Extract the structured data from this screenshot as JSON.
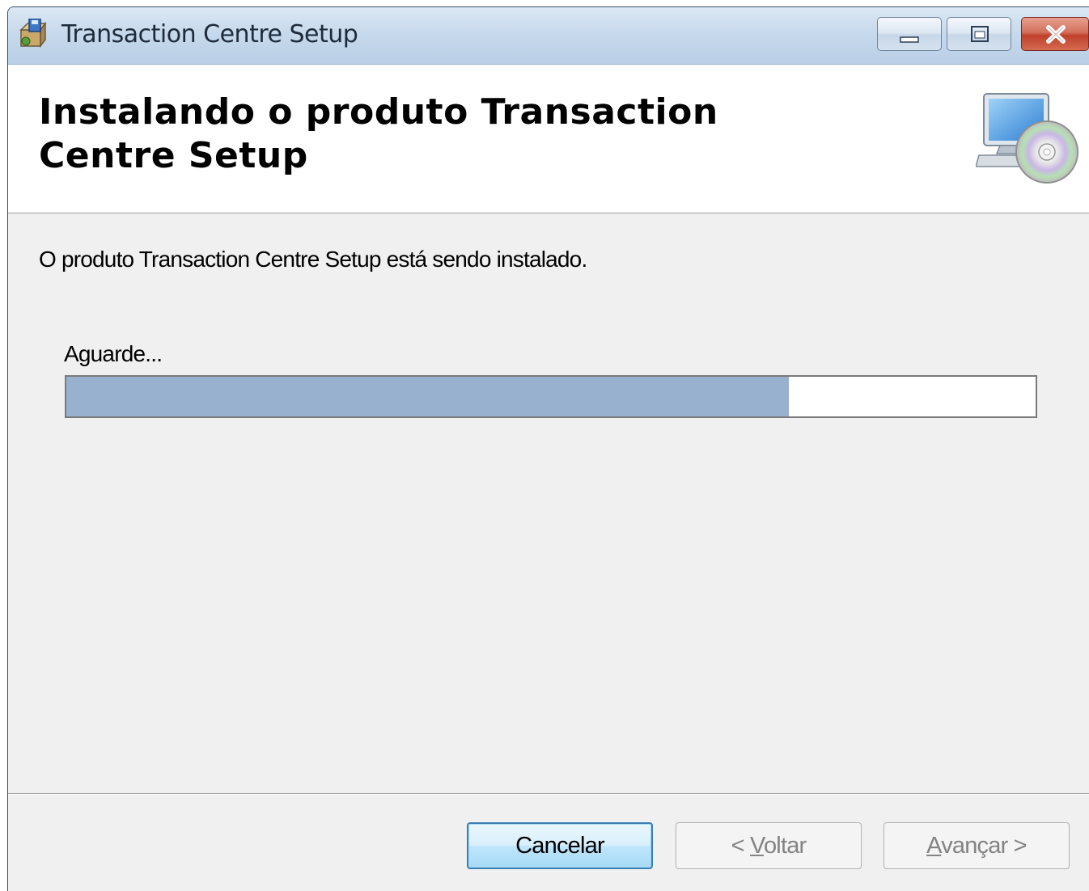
{
  "window": {
    "title": "Transaction Centre Setup"
  },
  "header": {
    "title": "Instalando o produto Transaction Centre Setup"
  },
  "body": {
    "description": "O produto Transaction Centre Setup está sendo instalado.",
    "status_label": "Aguarde...",
    "progress_fraction": 0.745
  },
  "buttons": {
    "cancel": "Cancelar",
    "back_prefix": "< ",
    "back_mnemonic": "V",
    "back_rest": "oltar",
    "next_mnemonic": "A",
    "next_rest": "vançar >"
  },
  "colors": {
    "progress_fill": "#97b1cf",
    "titlebar": "#c7d9ec",
    "close_button": "#c0412b"
  },
  "icons": {
    "app": "installer-package-icon",
    "header": "computer-with-cd-icon",
    "minimize": "minimize-icon",
    "maximize": "maximize-icon",
    "close": "close-icon"
  }
}
